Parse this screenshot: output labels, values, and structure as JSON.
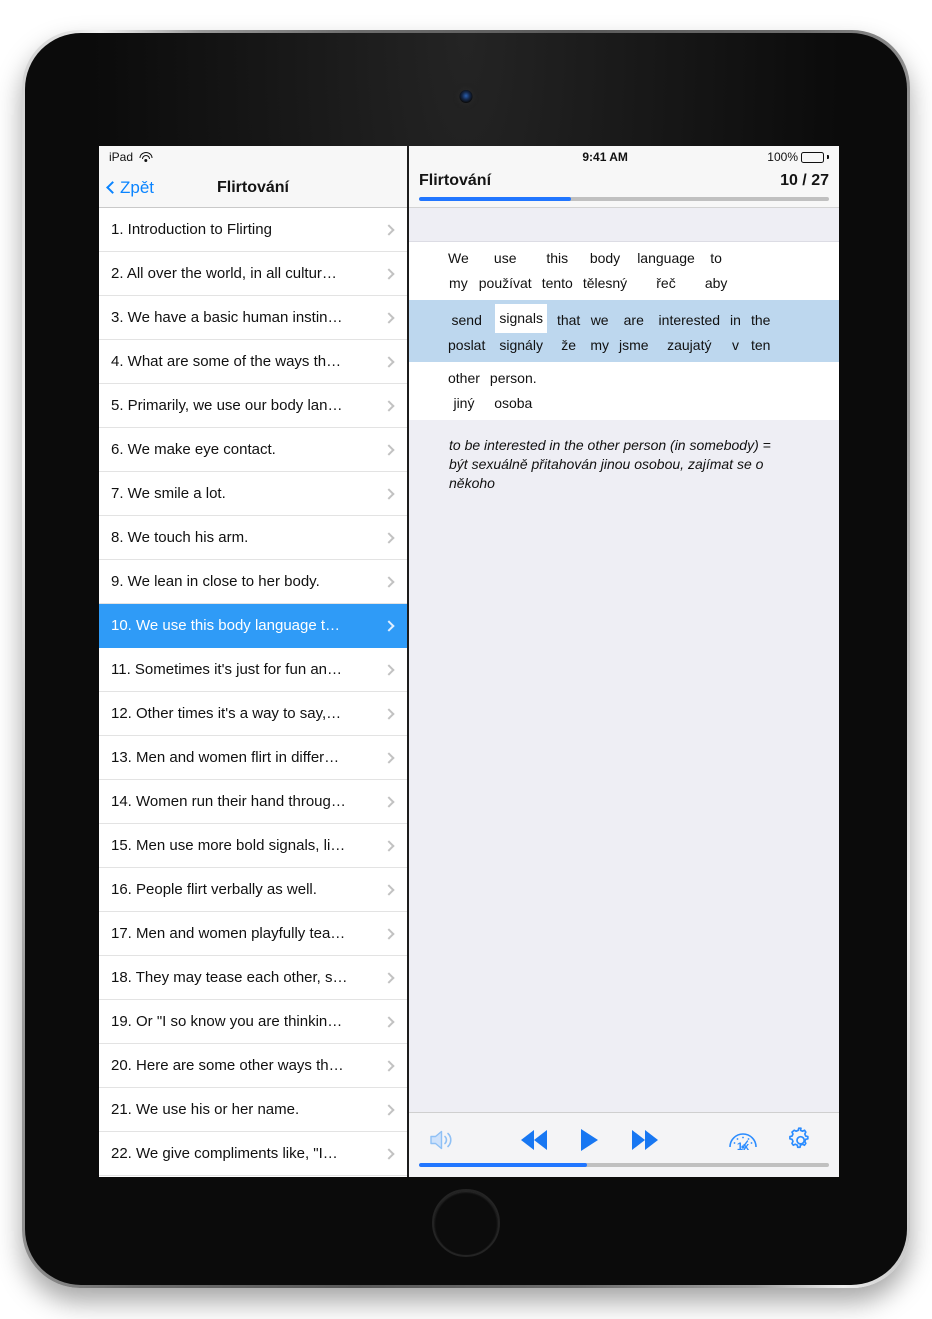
{
  "device": {
    "camera_icon": "camera-dot",
    "home_button_icon": "home-button"
  },
  "status_bar": {
    "device_name": "iPad",
    "wifi_icon": "wifi-icon",
    "clock": "9:41 AM",
    "battery_percent": "100%",
    "battery_icon": "battery-full-icon"
  },
  "sidebar": {
    "back_label": "Zpět",
    "back_icon": "chevron-left-icon",
    "title": "Flirtování",
    "disclosure_icon": "chevron-right-icon",
    "selected_index": 9,
    "items": [
      {
        "label": "1. Introduction to Flirting"
      },
      {
        "label": "2. All over the world, in all cultur…"
      },
      {
        "label": "3. We have a basic human instin…"
      },
      {
        "label": "4. What are some of the ways th…"
      },
      {
        "label": "5. Primarily, we use our body lan…"
      },
      {
        "label": "6. We make eye contact."
      },
      {
        "label": "7. We smile a lot."
      },
      {
        "label": "8. We touch his arm."
      },
      {
        "label": "9. We lean in close to her body."
      },
      {
        "label": "10. We use this body language t…"
      },
      {
        "label": "11. Sometimes it's just for fun an…"
      },
      {
        "label": "12. Other times it's a way to say,…"
      },
      {
        "label": "13. Men and women flirt in differ…"
      },
      {
        "label": "14. Women run their hand throug…"
      },
      {
        "label": "15. Men use more bold signals, li…"
      },
      {
        "label": "16. People flirt verbally as well."
      },
      {
        "label": "17. Men and women playfully tea…"
      },
      {
        "label": "18. They may tease each other, s…"
      },
      {
        "label": "19. Or \"I so know you are thinkin…"
      },
      {
        "label": "20. Here are some other ways th…"
      },
      {
        "label": "21. We use his or her name."
      },
      {
        "label": "22. We give compliments like, \"I…"
      }
    ]
  },
  "reader": {
    "title": "Flirtování",
    "page_counter": "10 / 27",
    "progress_percent": 37,
    "lines": [
      {
        "highlighted": false,
        "pairs": [
          {
            "en": "We",
            "cs": "my",
            "current": false
          },
          {
            "en": "use",
            "cs": "používat",
            "current": false
          },
          {
            "en": "this",
            "cs": "tento",
            "current": false
          },
          {
            "en": "body",
            "cs": "tělesný",
            "current": false
          },
          {
            "en": "language",
            "cs": "řeč",
            "current": false
          },
          {
            "en": "to",
            "cs": "aby",
            "current": false
          }
        ]
      },
      {
        "highlighted": true,
        "pairs": [
          {
            "en": "send",
            "cs": "poslat",
            "current": false
          },
          {
            "en": "signals",
            "cs": "signály",
            "current": true
          },
          {
            "en": "that",
            "cs": "že",
            "current": false
          },
          {
            "en": "we",
            "cs": "my",
            "current": false
          },
          {
            "en": "are",
            "cs": "jsme",
            "current": false
          },
          {
            "en": "interested",
            "cs": "zaujatý",
            "current": false
          },
          {
            "en": "in",
            "cs": "v",
            "current": false
          },
          {
            "en": "the",
            "cs": "ten",
            "current": false
          }
        ]
      },
      {
        "highlighted": false,
        "pairs": [
          {
            "en": "other",
            "cs": "jiný",
            "current": false
          },
          {
            "en": "person.",
            "cs": "osoba",
            "current": false
          }
        ]
      }
    ],
    "note": "to be interested in the other person (in somebody) = být sexuálně přitahován jinou osobou, zajímat se o někoho"
  },
  "toolbar": {
    "speaker_icon": "speaker-volume-icon",
    "rewind_icon": "rewind-icon",
    "play_icon": "play-icon",
    "forward_icon": "fast-forward-icon",
    "speed_icon": "speedometer-icon",
    "speed_label": "1x",
    "settings_icon": "gear-icon",
    "progress_percent": 41
  },
  "colors": {
    "accent_blue": "#2176ff",
    "selection_blue": "#2f9bf7",
    "highlight_row": "#bdd7ee",
    "icon_blue": "#1877f2",
    "note_bg": "#eeeef4"
  }
}
